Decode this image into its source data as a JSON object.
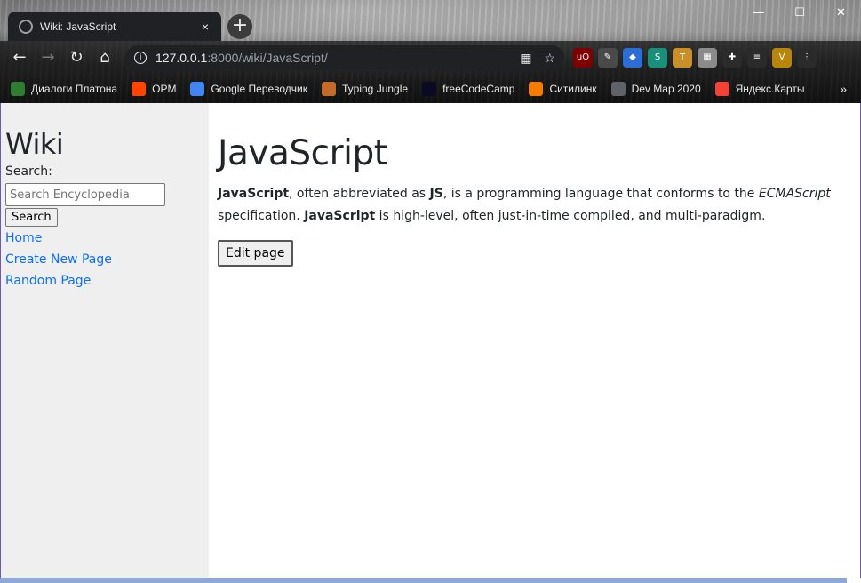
{
  "browser": {
    "tab": {
      "title": "Wiki: JavaScript",
      "close": "×"
    },
    "new_tab": "+",
    "window_controls": {
      "minimize": "—",
      "maximize": "☐",
      "close": "✕"
    },
    "toolbar": {
      "back": "←",
      "forward": "→",
      "reload": "↻",
      "home": "⌂"
    },
    "address": {
      "host": "127.0.0.1",
      "rest": ":8000/wiki/JavaScript/"
    },
    "omnibox_icons": [
      "qr-code-icon",
      "star-icon"
    ],
    "extensions": [
      {
        "name": "ublock-icon",
        "label": "uO",
        "color": "#800000"
      },
      {
        "name": "extension-2-icon",
        "label": "✎",
        "color": "#4a4a4a"
      },
      {
        "name": "diamond-icon",
        "label": "◆",
        "color": "#2b6fd6"
      },
      {
        "name": "extension-s-icon",
        "label": "S",
        "color": "#1a8f7a"
      },
      {
        "name": "extension-t-icon",
        "label": "T",
        "color": "#c9902a"
      },
      {
        "name": "extension-doc-icon",
        "label": "▦",
        "color": "#8b8b8b"
      },
      {
        "name": "puzzle-icon",
        "label": "✚",
        "color": "#2b2b2b"
      },
      {
        "name": "media-icon",
        "label": "≡",
        "color": "#2b2b2b"
      },
      {
        "name": "extension-v-icon",
        "label": "V",
        "color": "#b8860b"
      },
      {
        "name": "menu-icon",
        "label": "⋮",
        "color": "#2b2b2b"
      }
    ],
    "bookmarks": [
      {
        "label": "Диалоги Платона",
        "color": "#2e7d32"
      },
      {
        "label": "OPM",
        "color": "#ff4500"
      },
      {
        "label": "Google Переводчик",
        "color": "#4285f4"
      },
      {
        "label": "Typing Jungle",
        "color": "#c46b2a"
      },
      {
        "label": "freeCodeCamp",
        "color": "#0a0a23"
      },
      {
        "label": "Ситилинк",
        "color": "#f57c00"
      },
      {
        "label": "Dev Map 2020",
        "color": "#5f6368"
      },
      {
        "label": "Яндекс.Карты",
        "color": "#f44336"
      }
    ],
    "bookmarks_more": "»"
  },
  "sidebar": {
    "title": "Wiki",
    "search_label": "Search:",
    "search_placeholder": "Search Encyclopedia",
    "search_button": "Search",
    "links": [
      "Home",
      "Create New Page",
      "Random Page"
    ]
  },
  "article": {
    "title": "JavaScript",
    "body": {
      "b1": "JavaScript",
      "t1": ", often abbreviated as ",
      "b2": "JS",
      "t2": ", is a programming language that conforms to the ",
      "i1": "ECMAScript",
      "t3": " specification. ",
      "b3": "JavaScript",
      "t4": " is high-level, often just-in-time compiled, and multi-paradigm."
    },
    "edit_button": "Edit page"
  }
}
